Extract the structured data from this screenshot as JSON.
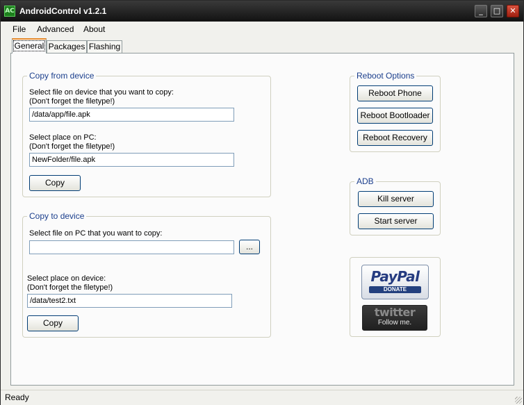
{
  "window": {
    "title": "AndroidControl v1.2.1",
    "icon": "android-app-icon",
    "icon_glyph": "AC",
    "controls": {
      "minimize": "_",
      "maximize": "□",
      "close": "✕"
    }
  },
  "menu": [
    "File",
    "Advanced",
    "About"
  ],
  "tabs": [
    {
      "label": "General",
      "active": true
    },
    {
      "label": "Packages",
      "active": false
    },
    {
      "label": "Flashing",
      "active": false
    }
  ],
  "copy_from_device": {
    "legend": "Copy from device",
    "device_file_label_1": "Select file on device that you want to copy:",
    "device_file_label_2": "(Don't forget the filetype!)",
    "device_file_value": "/data/app/file.apk",
    "pc_place_label_1": "Select place on PC:",
    "pc_place_label_2": "(Don't forget the filetype!)",
    "pc_place_value": "NewFolder/file.apk",
    "copy_button": "Copy"
  },
  "copy_to_device": {
    "legend": "Copy to device",
    "pc_file_label": "Select file on PC that you want to copy:",
    "pc_file_value": "",
    "browse_button": "...",
    "device_place_label_1": "Select place on device:",
    "device_place_label_2": "(Don't forget the filetype!)",
    "device_place_value": "/data/test2.txt",
    "copy_button": "Copy"
  },
  "reboot_options": {
    "legend": "Reboot Options",
    "buttons": [
      "Reboot Phone",
      "Reboot Bootloader",
      "Reboot Recovery"
    ]
  },
  "adb": {
    "legend": "ADB",
    "buttons": [
      "Kill server",
      "Start server"
    ]
  },
  "donate": {
    "paypal_word": "PayPal",
    "paypal_sub": "DONATE",
    "twitter_word": "twitter",
    "twitter_sub": "Follow me."
  },
  "status": {
    "text": "Ready"
  },
  "colors": {
    "legend": "#1a3e8c",
    "titlebar": "#1a1a1a",
    "active_tab_accent": "#e68b2c"
  }
}
